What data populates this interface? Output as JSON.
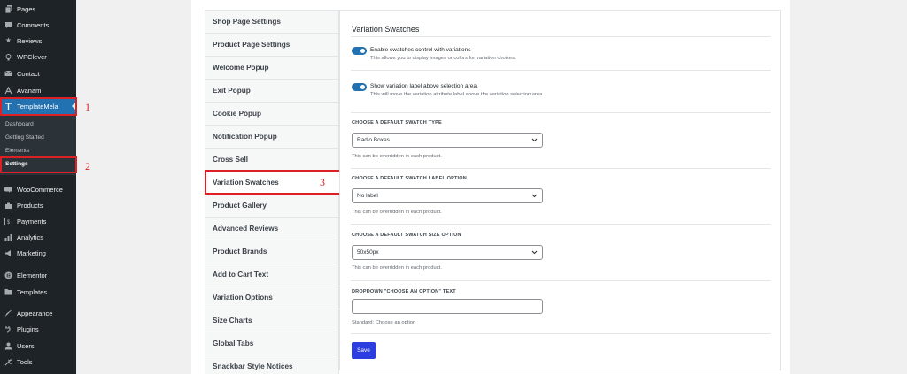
{
  "sidebar": {
    "items": [
      {
        "label": "Pages",
        "icon": "pages-icon"
      },
      {
        "label": "Comments",
        "icon": "comments-icon"
      },
      {
        "label": "Reviews",
        "icon": "reviews-icon"
      },
      {
        "label": "WPClever",
        "icon": "wpclever-icon"
      },
      {
        "label": "Contact",
        "icon": "contact-icon"
      },
      {
        "label": "Avanam",
        "icon": "avanam-icon"
      },
      {
        "label": "TemplateMela",
        "icon": "templatemela-icon",
        "active": true
      },
      {
        "label": "WooCommerce",
        "icon": "woocommerce-icon"
      },
      {
        "label": "Products",
        "icon": "products-icon"
      },
      {
        "label": "Payments",
        "icon": "payments-icon"
      },
      {
        "label": "Analytics",
        "icon": "analytics-icon"
      },
      {
        "label": "Marketing",
        "icon": "marketing-icon"
      },
      {
        "label": "Elementor",
        "icon": "elementor-icon"
      },
      {
        "label": "Templates",
        "icon": "templates-icon"
      },
      {
        "label": "Appearance",
        "icon": "appearance-icon"
      },
      {
        "label": "Plugins",
        "icon": "plugins-icon"
      },
      {
        "label": "Users",
        "icon": "users-icon"
      },
      {
        "label": "Tools",
        "icon": "tools-icon"
      }
    ],
    "submenu": [
      {
        "label": "Dashboard"
      },
      {
        "label": "Getting Started"
      },
      {
        "label": "Elements"
      },
      {
        "label": "Settings",
        "current": true
      }
    ]
  },
  "annotations": [
    "1",
    "2",
    "3"
  ],
  "settings_nav": {
    "items": [
      "Shop Page Settings",
      "Product Page Settings",
      "Welcome Popup",
      "Exit Popup",
      "Cookie Popup",
      "Notification Popup",
      "Cross Sell",
      "Variation Swatches",
      "Product Gallery",
      "Advanced Reviews",
      "Product Brands",
      "Add to Cart Text",
      "Variation Options",
      "Size Charts",
      "Global Tabs",
      "Snackbar Style Notices"
    ],
    "active_index": 7
  },
  "content": {
    "title": "Variation Swatches",
    "toggle1": {
      "label": "Enable swatches control with variations",
      "desc": "This allows you to display images or colors for variation choices.",
      "on": true
    },
    "toggle2": {
      "label": "Show variation label above selection area.",
      "desc": "This will move the variation attribute label above the variation selection area.",
      "on": true
    },
    "swatch_type": {
      "label": "CHOOSE A DEFAULT SWATCH TYPE",
      "value": "Radio Boxes",
      "help": "This can be overridden in each product."
    },
    "swatch_label": {
      "label": "CHOOSE A DEFAULT SWATCH LABEL OPTION",
      "value": "No label",
      "help": "This can be overridden in each product."
    },
    "swatch_size": {
      "label": "CHOOSE A DEFAULT SWATCH SIZE OPTION",
      "value": "50x50px",
      "help": "This can be overridden in each product."
    },
    "dropdown_text": {
      "label": "DROPDOWN \"CHOOSE AN OPTION\" TEXT",
      "value": "",
      "help": "Standard: Choose an option"
    },
    "save_label": "Save"
  },
  "colors": {
    "sidebar_bg": "#1d2327",
    "active_blue": "#2271b1",
    "annotation_red": "#dd1f26",
    "save_button": "#2c3ee0"
  }
}
